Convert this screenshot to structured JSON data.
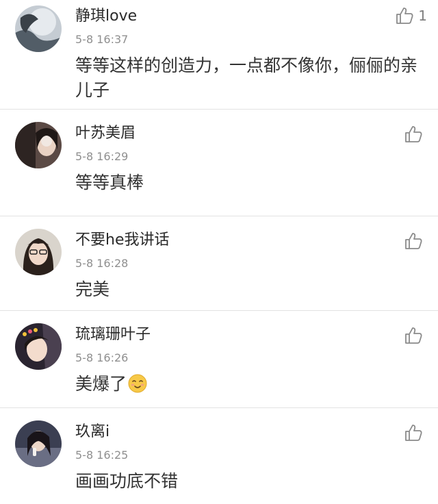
{
  "comments": [
    {
      "username": "静琪love",
      "timestamp": "5-8 16:37",
      "text": "等等这样的创造力，一点都不像你，俪俪的亲儿子",
      "likes": "1"
    },
    {
      "username": "叶苏美眉",
      "timestamp": "5-8 16:29",
      "text": "等等真棒",
      "likes": ""
    },
    {
      "username": "不要he我讲话",
      "timestamp": "5-8 16:28",
      "text": "完美",
      "likes": ""
    },
    {
      "username": "琉璃珊叶子",
      "timestamp": "5-8 16:26",
      "text": "美爆了",
      "emoji": "smiling-face-emoji",
      "likes": ""
    },
    {
      "username": "玖离i",
      "timestamp": "5-8 16:25",
      "text": "画画功底不错",
      "likes": ""
    }
  ],
  "icons": {
    "like": "thumbs-up-icon"
  },
  "colors": {
    "divider": "#e2e2e2",
    "timestamp": "#8f8f8f",
    "username": "#2a2a2a",
    "icon": "#8a8a8a"
  }
}
